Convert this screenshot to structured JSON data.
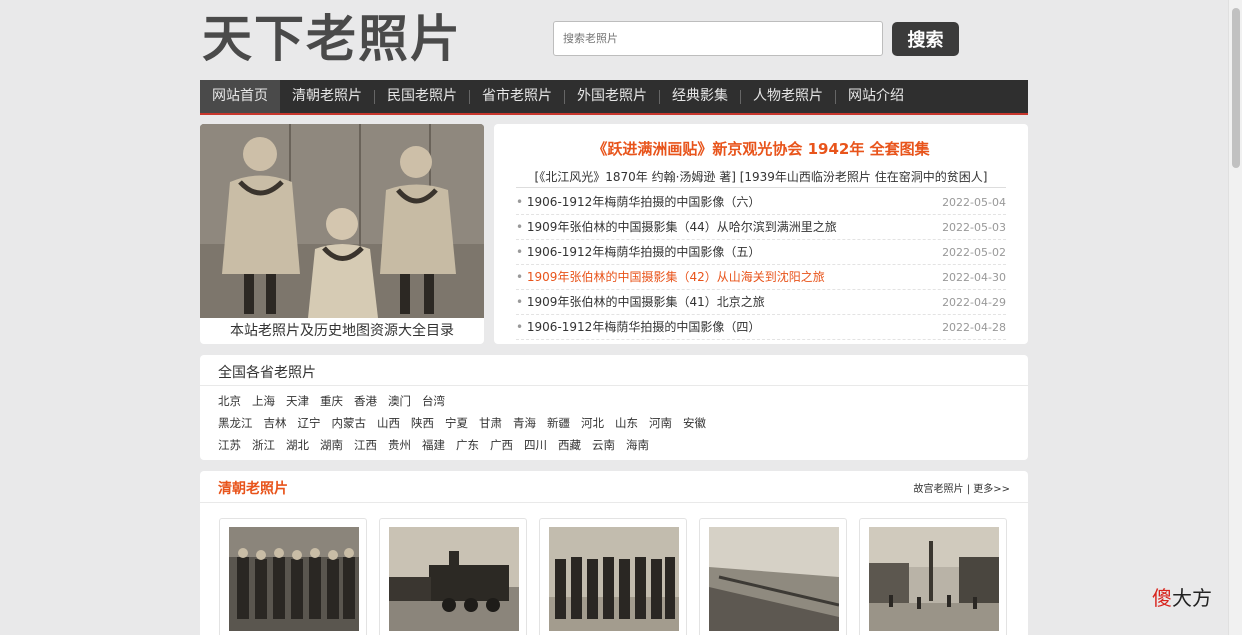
{
  "site": {
    "logo": "天下老照片"
  },
  "search": {
    "placeholder": "搜索老照片",
    "button": "搜索"
  },
  "nav": {
    "items": [
      "网站首页",
      "清朝老照片",
      "民国老照片",
      "省市老照片",
      "外国老照片",
      "经典影集",
      "人物老照片",
      "网站介绍"
    ],
    "active": "网站首页"
  },
  "feature": {
    "caption": "本站老照片及历史地图资源大全目录"
  },
  "news": {
    "headline": "《跃进满洲画贴》新京观光协会 1942年 全套图集",
    "sub": "[《北江风光》1870年 约翰·汤姆逊 著] [1939年山西临汾老照片 住在窑洞中的贫困人]",
    "items": [
      {
        "title": "1906-1912年梅荫华拍摄的中国影像（六）",
        "date": "2022-05-04"
      },
      {
        "title": "1909年张伯林的中国摄影集（44）从哈尔滨到满洲里之旅",
        "date": "2022-05-03"
      },
      {
        "title": "1906-1912年梅荫华拍摄的中国影像（五）",
        "date": "2022-05-02"
      },
      {
        "title": "1909年张伯林的中国摄影集（42）从山海关到沈阳之旅",
        "date": "2022-04-30",
        "highlight": true
      },
      {
        "title": "1909年张伯林的中国摄影集（41）北京之旅",
        "date": "2022-04-29"
      },
      {
        "title": "1906-1912年梅荫华拍摄的中国影像（四）",
        "date": "2022-04-28"
      }
    ]
  },
  "provinces": {
    "title": "全国各省老照片",
    "rows": [
      [
        "北京",
        "上海",
        "天津",
        "重庆",
        "香港",
        "澳门",
        "台湾"
      ],
      [
        "黑龙江",
        "吉林",
        "辽宁",
        "内蒙古",
        "山西",
        "陕西",
        "宁夏",
        "甘肃",
        "青海",
        "新疆",
        "河北",
        "山东",
        "河南",
        "安徽"
      ],
      [
        "江苏",
        "浙江",
        "湖北",
        "湖南",
        "江西",
        "贵州",
        "福建",
        "广东",
        "广西",
        "四川",
        "西藏",
        "云南",
        "海南"
      ]
    ]
  },
  "qing": {
    "title": "清朝老照片",
    "more": "故宫老照片 | 更多>>"
  },
  "watermark": {
    "part1": "傻",
    "part2": "大方"
  }
}
